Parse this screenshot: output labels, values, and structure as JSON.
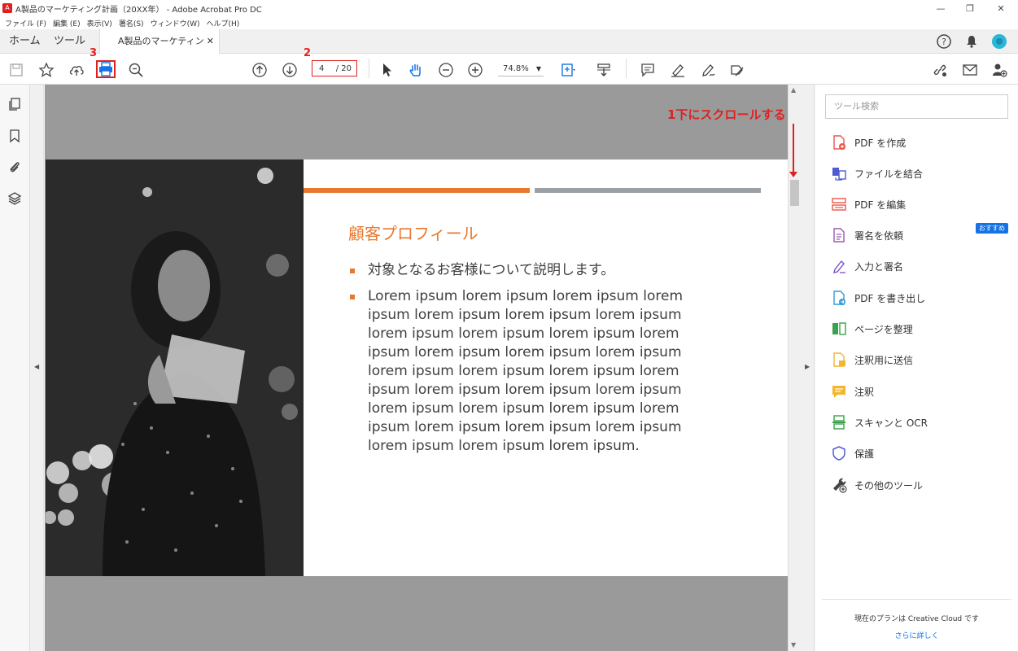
{
  "window": {
    "title": "A製品のマーケティング計画（20XX年） - Adobe Acrobat Pro DC",
    "controls": [
      "—",
      "❐",
      "✕"
    ]
  },
  "menu": [
    "ファイル (F)",
    "編集 (E)",
    "表示(V)",
    "署名(S)",
    "ウィンドウ(W)",
    "ヘルプ(H)"
  ],
  "tabs": {
    "home": "ホーム",
    "tools": "ツール",
    "doc": "A製品のマーケティング...",
    "close": "✕"
  },
  "toolbar": {
    "page_current": "4",
    "page_total": "/ 20",
    "zoom": "74.8%"
  },
  "annotations": {
    "step1": "1下にスクロールする",
    "step2": "2",
    "step3": "3"
  },
  "slide": {
    "title": "顧客プロフィール",
    "bullets": [
      "対象となるお客様について説明します。",
      "Lorem ipsum lorem ipsum lorem ipsum lorem ipsum lorem ipsum lorem ipsum lorem ipsum lorem ipsum lorem ipsum lorem ipsum lorem ipsum lorem ipsum lorem ipsum lorem ipsum lorem ipsum lorem ipsum lorem ipsum lorem ipsum lorem ipsum lorem ipsum lorem ipsum lorem ipsum lorem ipsum lorem ipsum lorem ipsum lorem ipsum lorem ipsum lorem ipsum lorem ipsum lorem ipsum lorem ipsum."
    ]
  },
  "right_panel": {
    "search_placeholder": "ツール検索",
    "tools": [
      {
        "label": "PDF を作成",
        "icon": "create-pdf-icon",
        "color": "#e8574a"
      },
      {
        "label": "ファイルを結合",
        "icon": "combine-files-icon",
        "color": "#4f5bd5"
      },
      {
        "label": "PDF を編集",
        "icon": "edit-pdf-icon",
        "color": "#e8574a"
      },
      {
        "label": "署名を依頼",
        "icon": "request-signature-icon",
        "color": "#9b59b6"
      },
      {
        "label": "入力と署名",
        "icon": "fill-sign-icon",
        "color": "#7b4fc9"
      },
      {
        "label": "PDF を書き出し",
        "icon": "export-pdf-icon",
        "color": "#2d9cdb"
      },
      {
        "label": "ページを整理",
        "icon": "organize-pages-icon",
        "color": "#38a34a"
      },
      {
        "label": "注釈用に送信",
        "icon": "send-comments-icon",
        "color": "#f2b630"
      },
      {
        "label": "注釈",
        "icon": "comment-icon",
        "color": "#f2b630"
      },
      {
        "label": "スキャンと OCR",
        "icon": "scan-ocr-icon",
        "color": "#38a34a"
      },
      {
        "label": "保護",
        "icon": "protect-icon",
        "color": "#4f5bd5"
      },
      {
        "label": "その他のツール",
        "icon": "more-tools-icon",
        "color": "#444444"
      }
    ],
    "badge": "おすすめ",
    "plan_text": "現在のプランは Creative Cloud です",
    "plan_link": "さらに詳しく"
  },
  "colors": {
    "accent_orange": "#e8782f",
    "annotation_red": "#e02020",
    "link_blue": "#1473e6"
  }
}
